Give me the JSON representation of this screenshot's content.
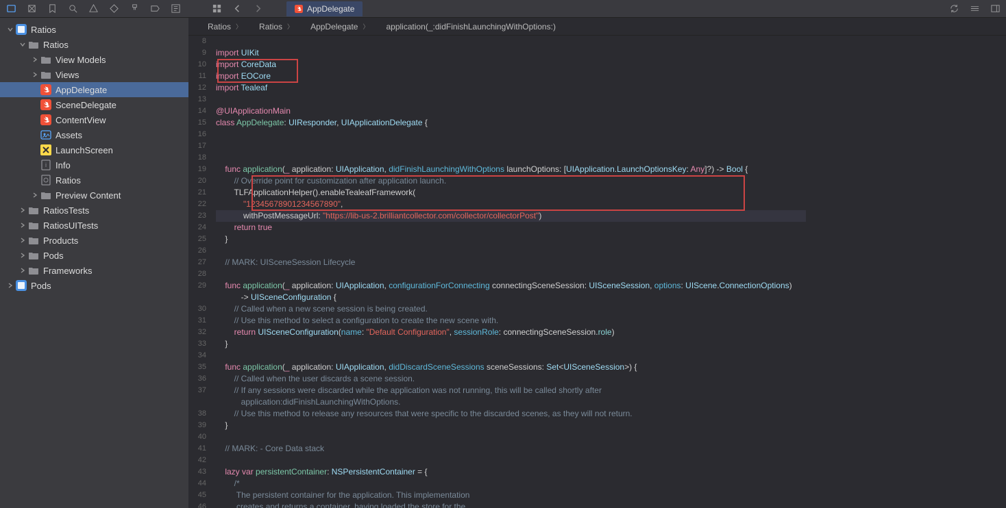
{
  "tab": {
    "label": "AppDelegate"
  },
  "crumbs": [
    "Ratios",
    "Ratios",
    "AppDelegate",
    "application(_:didFinishLaunchingWithOptions:)"
  ],
  "crumb_icons": [
    "app",
    "folder",
    "swift",
    "method"
  ],
  "sidebar": [
    {
      "d": 0,
      "ch": "down",
      "icon": "app",
      "label": "Ratios"
    },
    {
      "d": 1,
      "ch": "down",
      "icon": "folder",
      "label": "Ratios"
    },
    {
      "d": 2,
      "ch": "right",
      "icon": "folder",
      "label": "View Models"
    },
    {
      "d": 2,
      "ch": "right",
      "icon": "folder",
      "label": "Views"
    },
    {
      "d": 2,
      "ch": "none",
      "icon": "swift",
      "label": "AppDelegate",
      "sel": true
    },
    {
      "d": 2,
      "ch": "none",
      "icon": "swift",
      "label": "SceneDelegate"
    },
    {
      "d": 2,
      "ch": "none",
      "icon": "swift",
      "label": "ContentView"
    },
    {
      "d": 2,
      "ch": "none",
      "icon": "assets",
      "label": "Assets"
    },
    {
      "d": 2,
      "ch": "none",
      "icon": "xc",
      "label": "LaunchScreen"
    },
    {
      "d": 2,
      "ch": "none",
      "icon": "info",
      "label": "Info"
    },
    {
      "d": 2,
      "ch": "none",
      "icon": "doc",
      "label": "Ratios"
    },
    {
      "d": 2,
      "ch": "right",
      "icon": "folder",
      "label": "Preview Content"
    },
    {
      "d": 1,
      "ch": "right",
      "icon": "folder",
      "label": "RatiosTests"
    },
    {
      "d": 1,
      "ch": "right",
      "icon": "folder",
      "label": "RatiosUITests"
    },
    {
      "d": 1,
      "ch": "right",
      "icon": "folder",
      "label": "Products"
    },
    {
      "d": 1,
      "ch": "right",
      "icon": "folder",
      "label": "Pods"
    },
    {
      "d": 1,
      "ch": "right",
      "icon": "folder",
      "label": "Frameworks"
    },
    {
      "d": 0,
      "ch": "right",
      "icon": "app",
      "label": "Pods"
    }
  ],
  "code": [
    {
      "n": 8,
      "h": ""
    },
    {
      "n": 9,
      "h": "<span class='kw'>import</span> <span class='typ'>UIKit</span>"
    },
    {
      "n": 10,
      "h": "<span class='kw'>import</span> <span class='typ'>CoreData</span>"
    },
    {
      "n": 11,
      "h": "<span class='kw'>import</span> <span class='typ'>EOCore</span>"
    },
    {
      "n": 12,
      "h": "<span class='kw'>import</span> <span class='typ'>Tealeaf</span>"
    },
    {
      "n": 13,
      "h": ""
    },
    {
      "n": 14,
      "h": "<span class='attr'>@UIApplicationMain</span>"
    },
    {
      "n": 15,
      "h": "<span class='kw'>class</span> <span class='fn'>AppDelegate</span>: <span class='typ'>UIResponder</span>, <span class='typ'>UIApplicationDelegate</span> {"
    },
    {
      "n": 16,
      "h": ""
    },
    {
      "n": 17,
      "h": ""
    },
    {
      "n": 18,
      "h": ""
    },
    {
      "n": 19,
      "h": "    <span class='kw'>func</span> <span class='fn'>application</span>(<span class='kw'>_</span> application: <span class='typ'>UIApplication</span>, <span class='param'>didFinishLaunchingWithOptions</span> launchOptions: [<span class='typ'>UIApplication</span>.<span class='typ'>LaunchOptionsKey</span>: <span class='kw'>Any</span>]?) -> <span class='typ'>Bool</span> {"
    },
    {
      "n": 20,
      "h": "        <span class='cmt'>// Override point for customization after application launch.</span>"
    },
    {
      "n": 21,
      "h": "        TLFApplicationHelper().enableTealeafFramework("
    },
    {
      "n": 22,
      "h": "            <span class='str'>\"12345678901234567890\"</span>,"
    },
    {
      "n": 23,
      "hl": true,
      "h": "            withPostMessageUrl: <span class='str'>\"https://lib-us-2.brilliantcollector.com/collector/collectorPost\"</span>)"
    },
    {
      "n": 24,
      "h": "        <span class='kw'>return</span> <span class='kw'>true</span>"
    },
    {
      "n": 25,
      "h": "    }"
    },
    {
      "n": 26,
      "h": ""
    },
    {
      "n": 27,
      "h": "    <span class='cmt'>// MARK: UISceneSession Lifecycle</span>"
    },
    {
      "n": 28,
      "h": ""
    },
    {
      "n": 29,
      "h": "    <span class='kw'>func</span> <span class='fn'>application</span>(<span class='kw'>_</span> application: <span class='typ'>UIApplication</span>, <span class='param'>configurationForConnecting</span> connectingSceneSession: <span class='typ'>UISceneSession</span>, <span class='param'>options</span>: <span class='typ'>UIScene</span>.<span class='typ'>ConnectionOptions</span>)<br>           -> <span class='typ'>UISceneConfiguration</span> {"
    },
    {
      "n": 30,
      "h": "        <span class='cmt'>// Called when a new scene session is being created.</span>"
    },
    {
      "n": 31,
      "h": "        <span class='cmt'>// Use this method to select a configuration to create the new scene with.</span>"
    },
    {
      "n": 32,
      "h": "        <span class='kw'>return</span> <span class='typ'>UISceneConfiguration</span>(<span class='param'>name</span>: <span class='str'>\"Default Configuration\"</span>, <span class='param'>sessionRole</span>: connectingSceneSession.<span class='prop'>role</span>)"
    },
    {
      "n": 33,
      "h": "    }"
    },
    {
      "n": 34,
      "h": ""
    },
    {
      "n": 35,
      "h": "    <span class='kw'>func</span> <span class='fn'>application</span>(<span class='kw'>_</span> application: <span class='typ'>UIApplication</span>, <span class='param'>didDiscardSceneSessions</span> sceneSessions: <span class='typ'>Set</span>&lt;<span class='typ'>UISceneSession</span>&gt;) {"
    },
    {
      "n": 36,
      "h": "        <span class='cmt'>// Called when the user discards a scene session.</span>"
    },
    {
      "n": 37,
      "h": "        <span class='cmt'>// If any sessions were discarded while the application was not running, this will be called shortly after<br>           application:didFinishLaunchingWithOptions.</span>"
    },
    {
      "n": 38,
      "h": "        <span class='cmt'>// Use this method to release any resources that were specific to the discarded scenes, as they will not return.</span>"
    },
    {
      "n": 39,
      "h": "    }"
    },
    {
      "n": 40,
      "h": ""
    },
    {
      "n": 41,
      "h": "    <span class='cmt'>// MARK: - Core Data stack</span>"
    },
    {
      "n": 42,
      "h": ""
    },
    {
      "n": 43,
      "h": "    <span class='kw'>lazy var</span> <span class='fn'>persistentContainer</span>: <span class='typ'>NSPersistentContainer</span> = {"
    },
    {
      "n": 44,
      "h": "        <span class='cmt'>/*</span>"
    },
    {
      "n": 45,
      "h": "        <span class='cmt'> The persistent container for the application. This implementation</span>"
    },
    {
      "n": 46,
      "h": "        <span class='cmt'> creates and returns a container, having loaded the store for the</span>"
    }
  ]
}
